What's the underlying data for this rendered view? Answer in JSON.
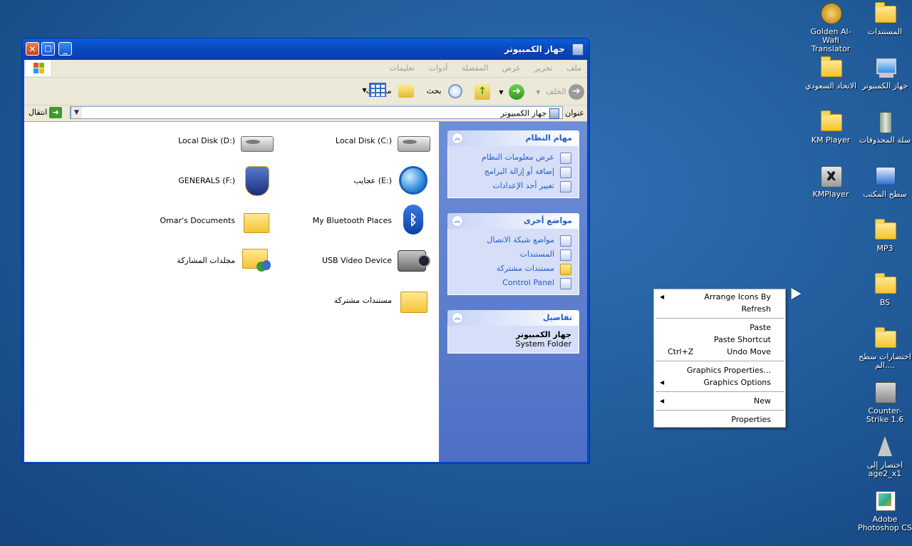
{
  "desktop_icons": [
    {
      "label": "المستندات",
      "icon": "documents-folder-icon"
    },
    {
      "label": "Golden Al-Wafi Translator",
      "icon": "translator-app-icon"
    },
    {
      "label": "جهاز الكمبيوتر",
      "icon": "my-computer-icon"
    },
    {
      "label": "الاتحاد السعودي",
      "icon": "folder-icon"
    },
    {
      "label": "سلة المحذوفات",
      "icon": "recycle-bin-icon"
    },
    {
      "label": "KM Player",
      "icon": "folder-icon"
    },
    {
      "label": "سطح المكتب",
      "icon": "desktop-shortcut-icon"
    },
    {
      "label": "KMPlayer",
      "icon": "kmplayer-icon"
    },
    {
      "label": "MP3",
      "icon": "folder-icon"
    },
    {
      "label": "BS",
      "icon": "folder-icon"
    },
    {
      "label": "اختصارات سطح الم....",
      "icon": "folder-icon"
    },
    {
      "label": "Counter-Strike 1.6",
      "icon": "counter-strike-icon"
    },
    {
      "label": "اختصار إلى age2_x1",
      "icon": "age-of-empires-icon"
    },
    {
      "label": "Adobe Photoshop CS",
      "icon": "photoshop-icon"
    }
  ],
  "window": {
    "title": "جهاز الكمبيوتر",
    "menu": [
      "ملف",
      "تحرير",
      "عرض",
      "المفضلة",
      "أدوات",
      "تعليمات"
    ],
    "toolbar": {
      "back": "الخلف",
      "search": "بحث",
      "folders": "مجلدات"
    },
    "address": {
      "label": "عنوان",
      "value": "جهاز الكمبيوتر",
      "go": "انتقال"
    }
  },
  "taskpane": {
    "system_tasks": {
      "title": "مهام النظام",
      "links": [
        "عرض معلومات النظام",
        "إضافة أو إزالة البرامج",
        "تغيير أحد الإعدادات"
      ]
    },
    "other_places": {
      "title": "مواضع أخرى",
      "links": [
        "مواضع شبكة الاتصال",
        "المستندات",
        "مستندات مشتركة",
        "Control Panel"
      ]
    },
    "details": {
      "title": "تفاصيل",
      "name": "جهاز الكمبيوتر",
      "type": "System Folder"
    }
  },
  "items": [
    {
      "label": "Local Disk (C:)",
      "icon": "hard-disk-icon"
    },
    {
      "label": "Local Disk (D:)",
      "icon": "hard-disk-icon"
    },
    {
      "label": "عجايب (E:)",
      "icon": "internet-explorer-drive-icon"
    },
    {
      "label": "GENERALS (F:)",
      "icon": "generals-drive-icon"
    },
    {
      "label": "My Bluetooth Places",
      "icon": "bluetooth-icon"
    },
    {
      "label": "Omar's Documents",
      "icon": "folder-icon"
    },
    {
      "label": "USB Video Device",
      "icon": "camcorder-icon"
    },
    {
      "label": "مجلدات المشاركة",
      "icon": "shared-folder-icon"
    },
    {
      "label": "مستندات مشتركة",
      "icon": "folder-icon"
    }
  ],
  "context_menu": {
    "arrange": "Arrange Icons By",
    "refresh": "Refresh",
    "paste": "Paste",
    "paste_shortcut": "Paste Shortcut",
    "undo_move": "Undo Move",
    "undo_shortcut": "Ctrl+Z",
    "graphics_properties": "Graphics Properties...",
    "graphics_options": "Graphics Options",
    "new": "New",
    "properties": "Properties"
  }
}
